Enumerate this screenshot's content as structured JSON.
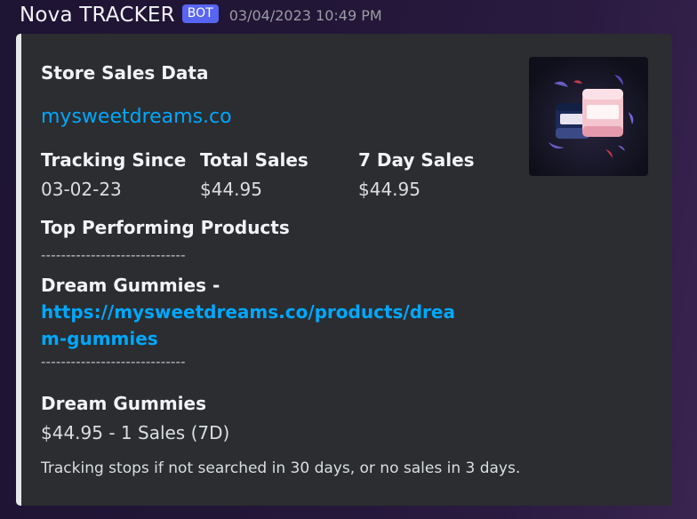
{
  "message": {
    "username": "Nova TRACKER",
    "bot_tag": "BOT",
    "timestamp": "03/04/2023 10:49 PM"
  },
  "embed": {
    "title": "Store Sales Data",
    "store_url": "mysweetdreams.co",
    "fields": [
      {
        "name": "Tracking Since",
        "value": "03-02-23"
      },
      {
        "name": "Total Sales",
        "value": "$44.95"
      },
      {
        "name": "7 Day Sales",
        "value": "$44.95"
      }
    ],
    "top_products_title": "Top Performing Products",
    "divider": "-----------------------------",
    "product_link_entry": {
      "name": "Dream Gummies -",
      "url": "https://mysweetdreams.co/products/dream-gummies"
    },
    "product_summary": {
      "name": "Dream Gummies",
      "detail": "$44.95 - 1 Sales (7D)"
    },
    "footer_note": "Tracking stops if not searched in 30 days, or no sales in 3 days.",
    "thumbnail_icon": "product-thumbnail-image",
    "accent_color": "#e8e8ea",
    "link_color": "#00a8fc"
  }
}
